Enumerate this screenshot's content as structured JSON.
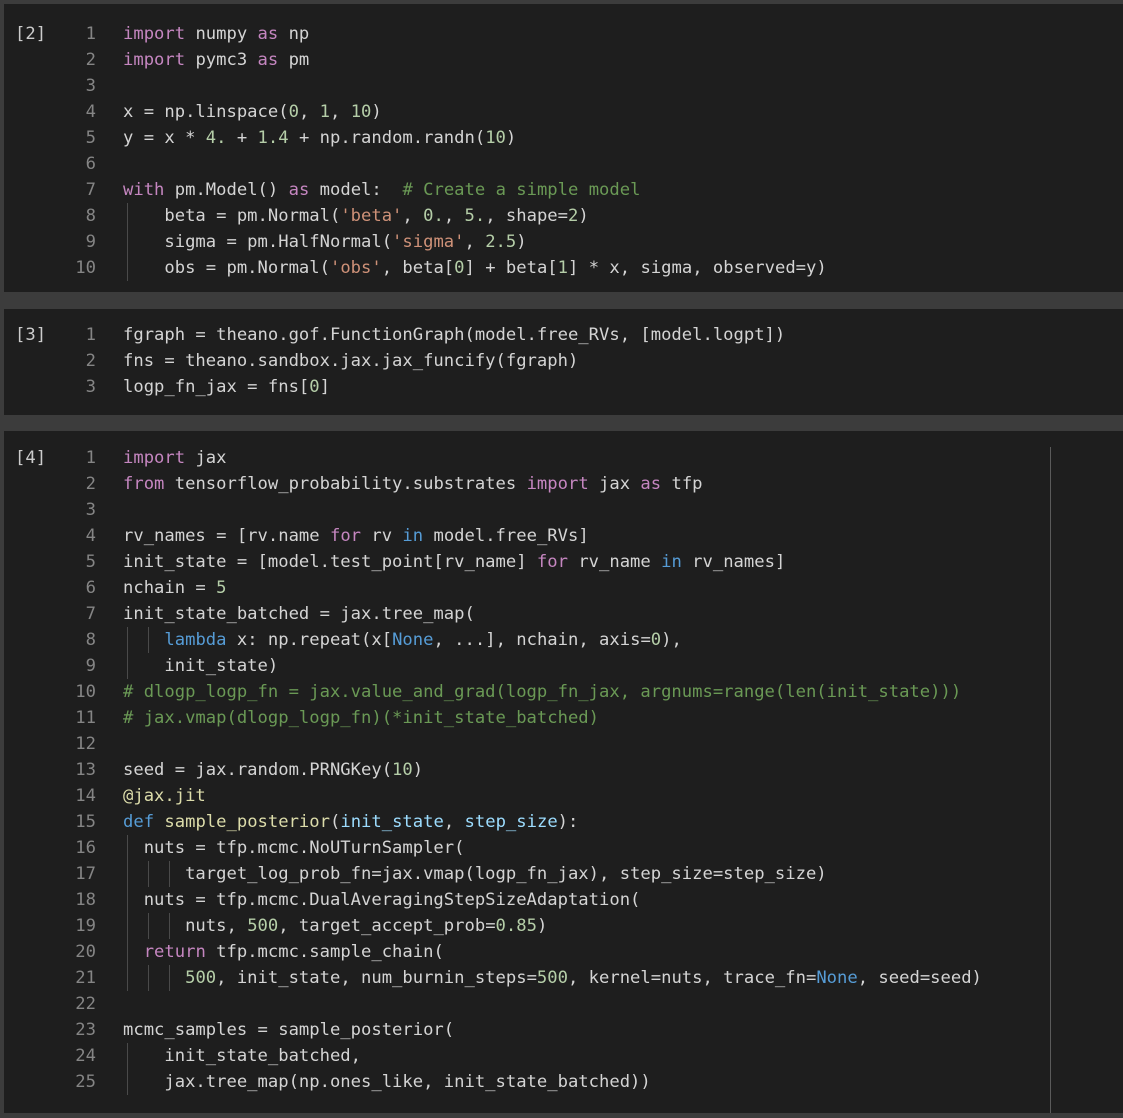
{
  "cells": [
    {
      "prompt": "[2]",
      "lines": [
        [
          [
            "kw",
            "import"
          ],
          [
            "plain",
            " numpy "
          ],
          [
            "kw",
            "as"
          ],
          [
            "plain",
            " np"
          ]
        ],
        [
          [
            "kw",
            "import"
          ],
          [
            "plain",
            " pymc3 "
          ],
          [
            "kw",
            "as"
          ],
          [
            "plain",
            " pm"
          ]
        ],
        [],
        [
          [
            "plain",
            "x = np.linspace("
          ],
          [
            "num",
            "0"
          ],
          [
            "plain",
            ", "
          ],
          [
            "num",
            "1"
          ],
          [
            "plain",
            ", "
          ],
          [
            "num",
            "10"
          ],
          [
            "plain",
            ")"
          ]
        ],
        [
          [
            "plain",
            "y = x * "
          ],
          [
            "num",
            "4."
          ],
          [
            "plain",
            " + "
          ],
          [
            "num",
            "1.4"
          ],
          [
            "plain",
            " + np.random.randn("
          ],
          [
            "num",
            "10"
          ],
          [
            "plain",
            ")"
          ]
        ],
        [],
        [
          [
            "kw",
            "with"
          ],
          [
            "plain",
            " pm.Model() "
          ],
          [
            "kw",
            "as"
          ],
          [
            "plain",
            " model:  "
          ],
          [
            "com",
            "# Create a simple model"
          ]
        ],
        [
          [
            "plain",
            "    beta = pm.Normal("
          ],
          [
            "str",
            "'beta'"
          ],
          [
            "plain",
            ", "
          ],
          [
            "num",
            "0."
          ],
          [
            "plain",
            ", "
          ],
          [
            "num",
            "5."
          ],
          [
            "plain",
            ", shape="
          ],
          [
            "num",
            "2"
          ],
          [
            "plain",
            ")"
          ]
        ],
        [
          [
            "plain",
            "    sigma = pm.HalfNormal("
          ],
          [
            "str",
            "'sigma'"
          ],
          [
            "plain",
            ", "
          ],
          [
            "num",
            "2.5"
          ],
          [
            "plain",
            ")"
          ]
        ],
        [
          [
            "plain",
            "    obs = pm.Normal("
          ],
          [
            "str",
            "'obs'"
          ],
          [
            "plain",
            ", beta["
          ],
          [
            "num",
            "0"
          ],
          [
            "plain",
            "] + beta["
          ],
          [
            "num",
            "1"
          ],
          [
            "plain",
            "] * x, sigma, observed=y)"
          ]
        ]
      ]
    },
    {
      "prompt": "[3]",
      "lines": [
        [
          [
            "plain",
            "fgraph = theano.gof.FunctionGraph(model.free_RVs, [model.logpt])"
          ]
        ],
        [
          [
            "plain",
            "fns = theano.sandbox.jax.jax_funcify(fgraph)"
          ]
        ],
        [
          [
            "plain",
            "logp_fn_jax = fns["
          ],
          [
            "num",
            "0"
          ],
          [
            "plain",
            "]"
          ]
        ]
      ]
    },
    {
      "prompt": "[4]",
      "lines": [
        [
          [
            "kw",
            "import"
          ],
          [
            "plain",
            " jax"
          ]
        ],
        [
          [
            "kw",
            "from"
          ],
          [
            "plain",
            " tensorflow_probability.substrates "
          ],
          [
            "kw",
            "import"
          ],
          [
            "plain",
            " jax "
          ],
          [
            "kw",
            "as"
          ],
          [
            "plain",
            " tfp"
          ]
        ],
        [],
        [
          [
            "plain",
            "rv_names = [rv.name "
          ],
          [
            "kw",
            "for"
          ],
          [
            "plain",
            " rv "
          ],
          [
            "kwb",
            "in"
          ],
          [
            "plain",
            " model.free_RVs]"
          ]
        ],
        [
          [
            "plain",
            "init_state = [model.test_point[rv_name] "
          ],
          [
            "kw",
            "for"
          ],
          [
            "plain",
            " rv_name "
          ],
          [
            "kwb",
            "in"
          ],
          [
            "plain",
            " rv_names]"
          ]
        ],
        [
          [
            "plain",
            "nchain = "
          ],
          [
            "num",
            "5"
          ]
        ],
        [
          [
            "plain",
            "init_state_batched = jax.tree_map("
          ]
        ],
        [
          [
            "plain",
            "    "
          ],
          [
            "kwb",
            "lambda"
          ],
          [
            "plain",
            " x: np.repeat(x["
          ],
          [
            "kwb",
            "None"
          ],
          [
            "plain",
            ", ...], nchain, axis="
          ],
          [
            "num",
            "0"
          ],
          [
            "plain",
            "),"
          ]
        ],
        [
          [
            "plain",
            "    init_state)"
          ]
        ],
        [
          [
            "com",
            "# dlogp_logp_fn = jax.value_and_grad(logp_fn_jax, argnums=range(len(init_state)))"
          ]
        ],
        [
          [
            "com",
            "# jax.vmap(dlogp_logp_fn)(*init_state_batched)"
          ]
        ],
        [],
        [
          [
            "plain",
            "seed = jax.random.PRNGKey("
          ],
          [
            "num",
            "10"
          ],
          [
            "plain",
            ")"
          ]
        ],
        [
          [
            "fn",
            "@jax.jit"
          ]
        ],
        [
          [
            "kwb",
            "def"
          ],
          [
            "plain",
            " "
          ],
          [
            "fn",
            "sample_posterior"
          ],
          [
            "plain",
            "("
          ],
          [
            "par",
            "init_state"
          ],
          [
            "plain",
            ", "
          ],
          [
            "par",
            "step_size"
          ],
          [
            "plain",
            "):"
          ]
        ],
        [
          [
            "plain",
            "  nuts = tfp.mcmc.NoUTurnSampler("
          ]
        ],
        [
          [
            "plain",
            "      target_log_prob_fn=jax.vmap(logp_fn_jax), step_size=step_size)"
          ]
        ],
        [
          [
            "plain",
            "  nuts = tfp.mcmc.DualAveragingStepSizeAdaptation("
          ]
        ],
        [
          [
            "plain",
            "      nuts, "
          ],
          [
            "num",
            "500"
          ],
          [
            "plain",
            ", target_accept_prob="
          ],
          [
            "num",
            "0.85"
          ],
          [
            "plain",
            ")"
          ]
        ],
        [
          [
            "plain",
            "  "
          ],
          [
            "kw",
            "return"
          ],
          [
            "plain",
            " tfp.mcmc.sample_chain("
          ]
        ],
        [
          [
            "plain",
            "      "
          ],
          [
            "num",
            "500"
          ],
          [
            "plain",
            ", init_state, num_burnin_steps="
          ],
          [
            "num",
            "500"
          ],
          [
            "plain",
            ", kernel=nuts, trace_fn="
          ],
          [
            "kwb",
            "None"
          ],
          [
            "plain",
            ", seed=seed)"
          ]
        ],
        [],
        [
          [
            "plain",
            "mcmc_samples = sample_posterior("
          ]
        ],
        [
          [
            "plain",
            "    init_state_batched,"
          ]
        ],
        [
          [
            "plain",
            "    jax.tree_map(np.ones_like, init_state_batched))"
          ]
        ]
      ]
    }
  ]
}
